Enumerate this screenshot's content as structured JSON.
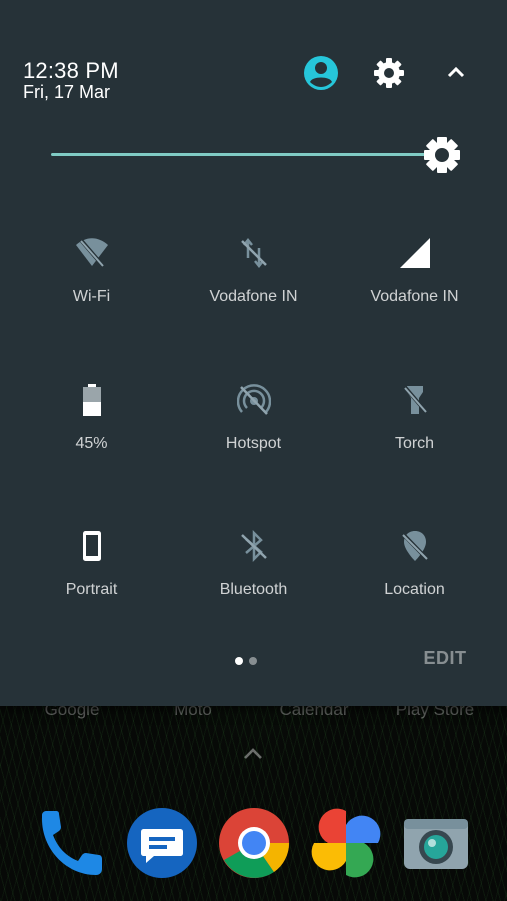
{
  "header": {
    "time": "12:38 PM",
    "date": "Fri, 17 Mar"
  },
  "colors": {
    "panel_bg": "#263238",
    "accent": "#26c6da",
    "slider": "#80cbc4"
  },
  "brightness": {
    "level": 0.98
  },
  "tiles": [
    {
      "label": "Wi-Fi",
      "icon": "wifi-off-icon"
    },
    {
      "label": "Vodafone IN",
      "icon": "mobile-data-off-icon"
    },
    {
      "label": "Vodafone IN",
      "icon": "signal-icon"
    },
    {
      "label": "45%",
      "icon": "battery-icon"
    },
    {
      "label": "Hotspot",
      "icon": "hotspot-off-icon"
    },
    {
      "label": "Torch",
      "icon": "torch-off-icon"
    },
    {
      "label": "Portrait",
      "icon": "portrait-icon"
    },
    {
      "label": "Bluetooth",
      "icon": "bluetooth-off-icon"
    },
    {
      "label": "Location",
      "icon": "location-off-icon"
    }
  ],
  "pager": {
    "pages": 2,
    "current": 1
  },
  "edit_label": "EDIT",
  "home": {
    "app_labels": [
      "Google",
      "Moto",
      "Calendar",
      "Play Store"
    ],
    "dock": [
      "Phone",
      "Messages",
      "Chrome",
      "Photos",
      "Camera"
    ]
  }
}
